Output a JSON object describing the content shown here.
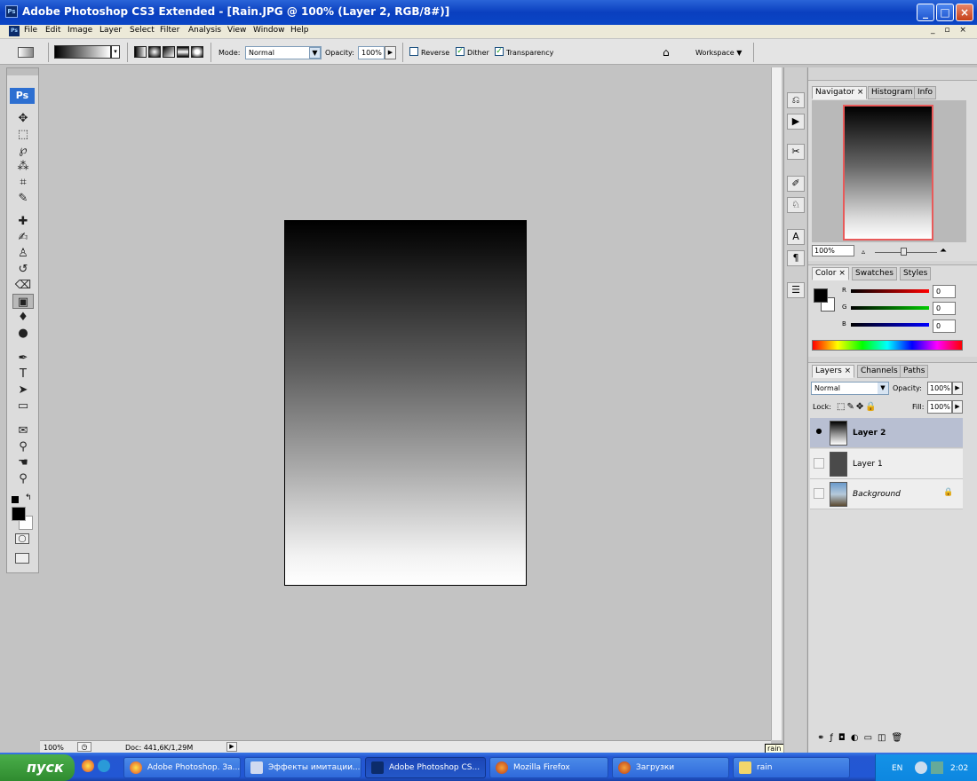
{
  "window": {
    "title": "Adobe Photoshop CS3 Extended - [Rain.JPG @ 100% (Layer 2, RGB/8#)]",
    "app_icon": "Ps",
    "controls": [
      "_",
      "□",
      "×"
    ]
  },
  "menubar": {
    "items": [
      "File",
      "Edit",
      "Image",
      "Layer",
      "Select",
      "Filter",
      "Analysis",
      "View",
      "Window",
      "Help"
    ],
    "doc_controls": "_ ▫ ×"
  },
  "options": {
    "mode_label": "Mode:",
    "mode_value": "Normal",
    "opacity_label": "Opacity:",
    "opacity_value": "100%",
    "reverse_label": "Reverse",
    "reverse_checked": false,
    "dither_label": "Dither",
    "dither_checked": true,
    "transparency_label": "Transparency",
    "transparency_checked": true,
    "workspace_label": "Workspace ▼"
  },
  "toolbox": {
    "logo": "Ps",
    "tools": [
      "move-icon",
      "marquee-icon",
      "lasso-icon",
      "magic-wand-icon",
      "crop-icon",
      "slice-icon",
      "healing-icon",
      "brush-icon",
      "stamp-icon",
      "history-brush-icon",
      "eraser-icon",
      "gradient-icon",
      "blur-icon",
      "dodge-icon",
      "pen-icon",
      "type-icon",
      "path-select-icon",
      "shape-icon",
      "notes-icon",
      "eyedropper-icon",
      "hand-icon",
      "zoom-icon"
    ]
  },
  "status": {
    "zoom": "100%",
    "doc_size": "Doc: 441,6K/1,29M"
  },
  "navigator": {
    "tabs": [
      "Navigator ×",
      "Histogram",
      "Info"
    ],
    "zoom": "100%"
  },
  "color_panel": {
    "tabs": [
      "Color ×",
      "Swatches",
      "Styles"
    ],
    "channels": [
      {
        "label": "R",
        "value": "0",
        "color": "#ff0000"
      },
      {
        "label": "G",
        "value": "0",
        "color": "#00cc00"
      },
      {
        "label": "B",
        "value": "0",
        "color": "#0000ff"
      }
    ]
  },
  "layers_panel": {
    "tabs": [
      "Layers ×",
      "Channels",
      "Paths"
    ],
    "blend_mode": "Normal",
    "opacity_label": "Opacity:",
    "opacity_value": "100%",
    "lock_label": "Lock:",
    "fill_label": "Fill:",
    "fill_value": "100%",
    "layers": [
      {
        "name": "Layer 2",
        "visible": true,
        "selected": true
      },
      {
        "name": "Layer 1",
        "visible": false,
        "selected": false
      },
      {
        "name": "Background",
        "visible": false,
        "selected": false
      }
    ]
  },
  "tooltip": "rain",
  "taskbar": {
    "start_label": "пуск",
    "items": [
      {
        "label": "Adobe Photoshop. За...",
        "active": false
      },
      {
        "label": "Эффекты имитации...",
        "active": false
      },
      {
        "label": "Adobe Photoshop CS...",
        "active": true
      },
      {
        "label": "Mozilla Firefox",
        "active": false
      },
      {
        "label": "Загрузки",
        "active": false
      },
      {
        "label": "rain",
        "active": false
      }
    ],
    "lang": "EN",
    "clock": "2:02"
  },
  "colors": {
    "titlebar": "#0a3fbf",
    "canvas_bg": "#c3c3c3",
    "layer_selected": "#b8bfd2",
    "taskbar": "#2457d2",
    "start": "#3a9a3a"
  }
}
